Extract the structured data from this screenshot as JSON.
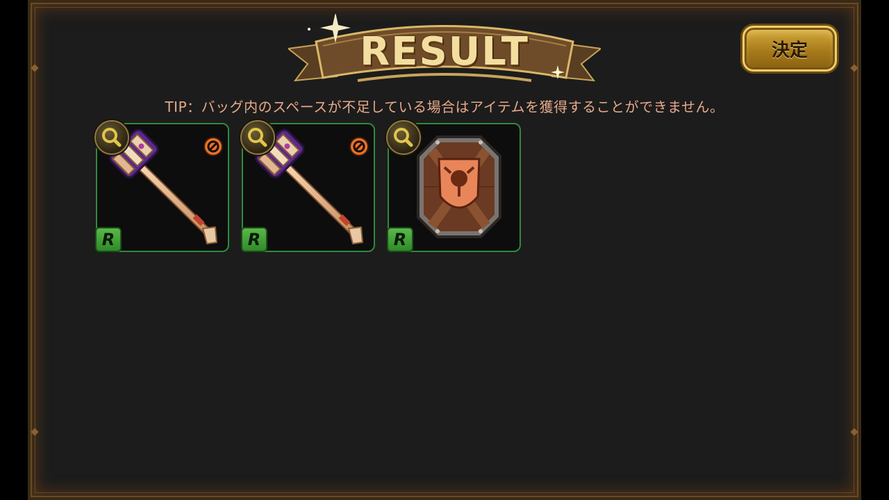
{
  "screen": {
    "title": "RESULT",
    "confirm_label": "決定",
    "tip": "TIP：バッグ内のスペースが不足している場合はアイテムを獲得することができません。"
  },
  "items": [
    {
      "type": "staff",
      "rarity": "R",
      "has_forbid_icon": true
    },
    {
      "type": "staff",
      "rarity": "R",
      "has_forbid_icon": true
    },
    {
      "type": "shield",
      "rarity": "R",
      "has_forbid_icon": false
    }
  ],
  "colors": {
    "background": "#1c1c1c",
    "frame": "#6b4a22",
    "item_border": "#2f8a3e",
    "tip_text": "#e6a98a",
    "title_text": "#f3dea0",
    "button_gold": "#c89a30"
  }
}
